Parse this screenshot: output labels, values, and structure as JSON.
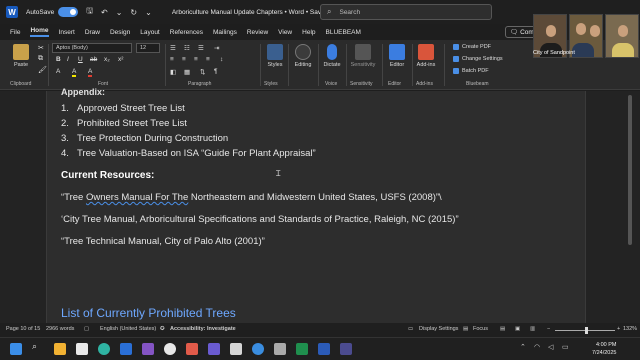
{
  "titlebar": {
    "app_letter": "W",
    "autosave_label": "AutoSave",
    "autosave_state": "On",
    "doc_title": "Arboriculture Manual Update Chapters  •  Word  •  Saved",
    "search_placeholder": "Search"
  },
  "menu": {
    "tabs": [
      "File",
      "Home",
      "Insert",
      "Draw",
      "Design",
      "Layout",
      "References",
      "Mailings",
      "Review",
      "View",
      "Help",
      "BLUEBEAM"
    ],
    "active": "Home",
    "comments_label": "Comm"
  },
  "ribbon": {
    "paste_label": "Paste",
    "clipboard_group": "Clipboard",
    "font_name": "Aptos (Body)",
    "font_size": "12",
    "font_group": "Font",
    "paragraph_group": "Paragraph",
    "styles_label": "Styles",
    "styles_group": "Styles",
    "editing_label": "Editing",
    "dictate_label": "Dictate",
    "voice_group": "Voice",
    "sensitivity_label": "Sensitivity",
    "sensitivity_group": "Sensitivity",
    "editor_label": "Editor",
    "editor_group": "Editor",
    "addins_label": "Add-ins",
    "addins_group": "Add-ins",
    "bluebeam_items": [
      "Create PDF",
      "Change Settings",
      "Batch PDF"
    ],
    "bluebeam_group": "Bluebeam",
    "format_buttons": [
      "B",
      "I",
      "U",
      "ab",
      "x₂",
      "x²",
      "A",
      "A",
      "A"
    ]
  },
  "video": {
    "participant_label": "City of Sandpoint"
  },
  "document": {
    "cut_heading": "Appendix:",
    "list_items": [
      {
        "num": "1.",
        "text": "Approved Street Tree List"
      },
      {
        "num": "2.",
        "text": "Prohibited Street Tree List"
      },
      {
        "num": "3.",
        "text": "Tree Protection During Construction"
      },
      {
        "num": "4.",
        "text": "Tree Valuation-Based on ISA “Guide For Plant Appraisal”"
      }
    ],
    "resources_heading": "Current Resources:",
    "resource_1_pre": "“Tree ",
    "resource_1_squig": "Owners Manual For The",
    "resource_1_post": " Northeastern and Midwestern United States, USFS (2008)”\\",
    "resource_2": "‘City Tree Manual, Arboricultural Specifications and Standards of Practice, Raleigh, NC (2015)”",
    "resource_3": "“Tree Technical Manual, City of Palo Alto (2001)”",
    "section_heading": "List of Currently Prohibited Trees"
  },
  "status": {
    "page": "Page 10 of 15",
    "words": "2966 words",
    "language": "English (United States)",
    "accessibility": "Accessibility: Investigate",
    "display_settings": "Display Settings",
    "focus": "Focus",
    "zoom": "132%"
  },
  "taskbar": {
    "time": "4:00 PM",
    "date": "7/24/2025"
  },
  "colors": {
    "accent": "#4a8fe7",
    "heading_blue": "#6ea8ff",
    "page_bg": "#2d2d2d"
  }
}
